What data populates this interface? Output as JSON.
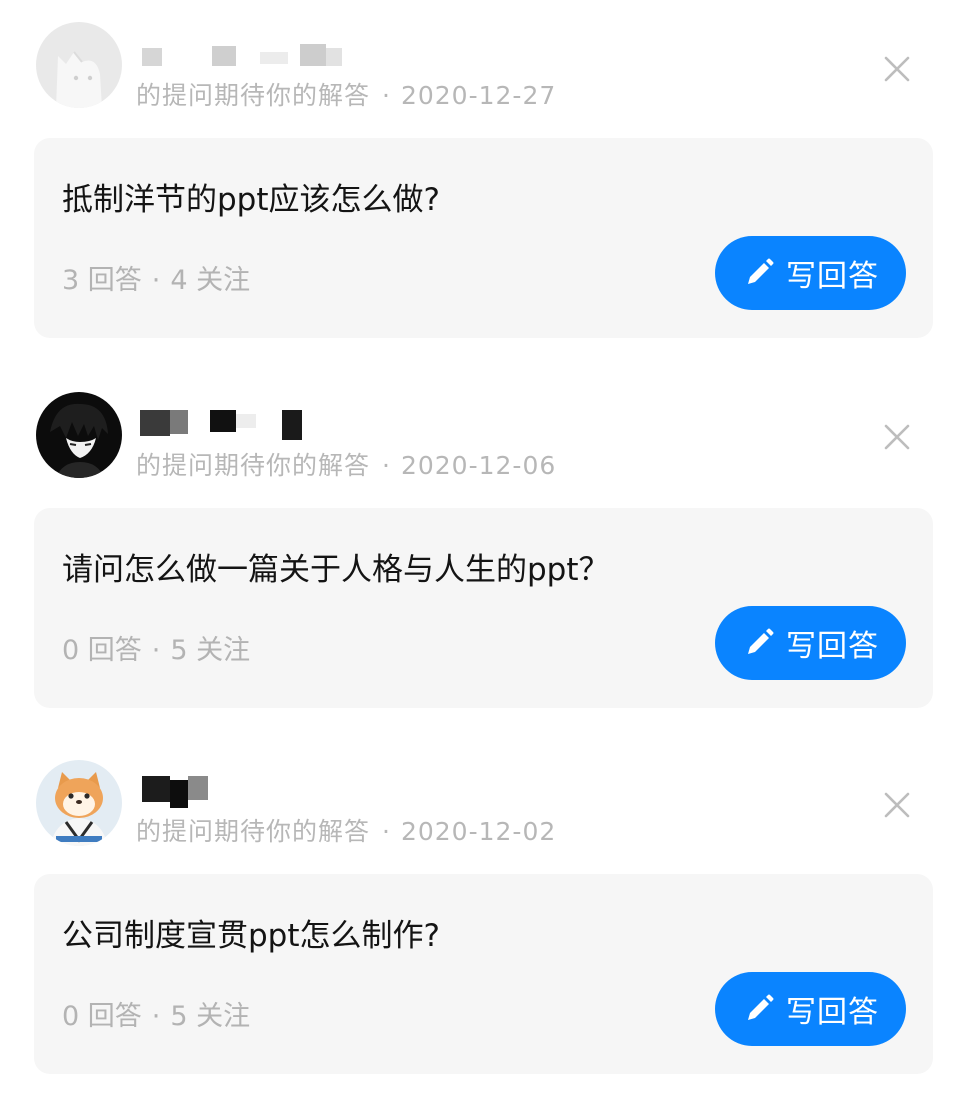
{
  "feed": {
    "items": [
      {
        "subtitle": "的提问期待你的解答",
        "date": "2020-12-27",
        "question": "抵制洋节的ppt应该怎么做?",
        "answers": "3 回答",
        "follows": "4 关注",
        "answer_button": "写回答"
      },
      {
        "subtitle": "的提问期待你的解答",
        "date": "2020-12-06",
        "question": "请问怎么做一篇关于人格与人生的ppt？",
        "answers": "0 回答",
        "follows": "5 关注",
        "answer_button": "写回答"
      },
      {
        "subtitle": "的提问期待你的解答",
        "date": "2020-12-02",
        "question": "公司制度宣贯ppt怎么制作?",
        "answers": "0 回答",
        "follows": "5 关注",
        "answer_button": "写回答"
      }
    ],
    "separator": "·"
  },
  "icons": {
    "close": "close-icon",
    "pencil": "pencil-icon"
  },
  "colors": {
    "accent": "#0a84ff",
    "card_bg": "#f6f6f6",
    "meta_text": "#b7b7b7",
    "title_text": "#141414"
  }
}
